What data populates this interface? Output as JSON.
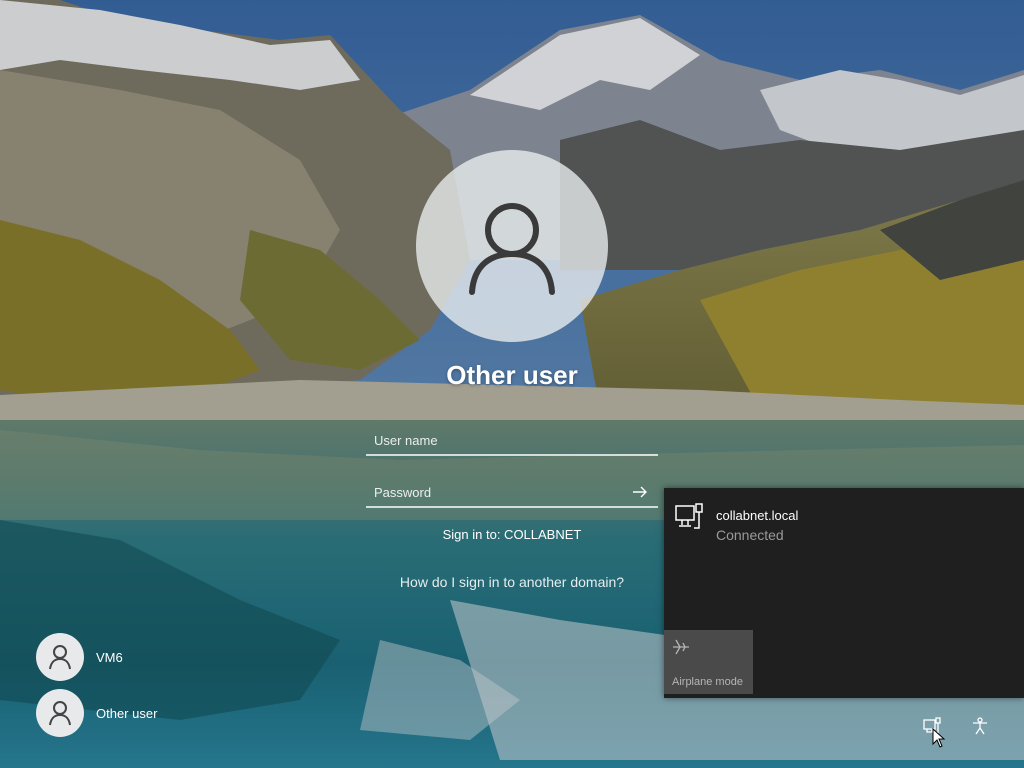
{
  "login": {
    "title": "Other user",
    "username_placeholder": "User name",
    "password_placeholder": "Password",
    "sign_in_to": "Sign in to: COLLABNET",
    "domain_link": "How do I sign in to another domain?"
  },
  "users": [
    {
      "name": "VM6"
    },
    {
      "name": "Other user"
    }
  ],
  "network_flyout": {
    "network_name": "collabnet.local",
    "network_status": "Connected",
    "tile_label": "Airplane mode",
    "tile_icon": "airplane-icon"
  },
  "tray": {
    "network_icon": "network-icon",
    "ease_icon": "accessibility-icon"
  }
}
